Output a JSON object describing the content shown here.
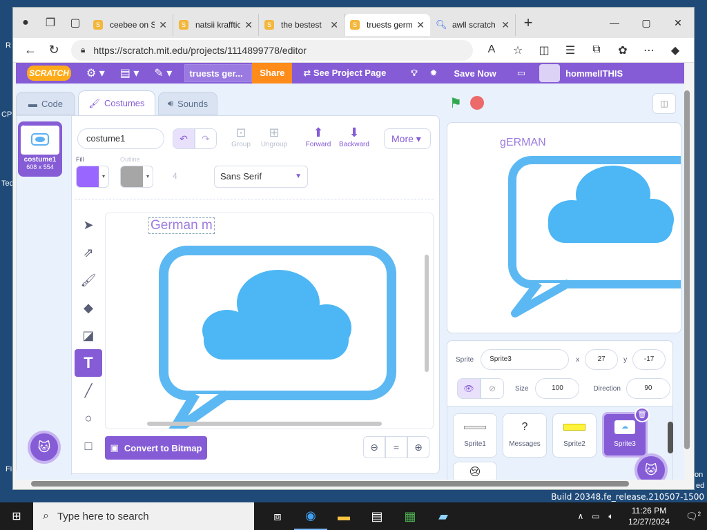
{
  "desktop": {
    "build_info": "Build 20348.fe_release.210507-1500",
    "side_text_1": "R",
    "side_text_2": "CP",
    "side_text_3": "Tec",
    "side_text_4": "Fi",
    "right_text_1": "on",
    "right_text_2": "ed"
  },
  "browser": {
    "tabs": [
      {
        "label": "ceebee on S",
        "favicon": "scratch-favicon"
      },
      {
        "label": "natsii krafftic",
        "favicon": "scratch-favicon"
      },
      {
        "label": "the bestest",
        "favicon": "scratch-favicon"
      },
      {
        "label": "truests germ",
        "favicon": "scratch-favicon",
        "active": true
      },
      {
        "label": "awll scratch",
        "favicon": "search-icon"
      }
    ],
    "url": "https://scratch.mit.edu/projects/1114899778/editor"
  },
  "scratch": {
    "logo": "SCRATCH",
    "project_title": "truests ger...",
    "share_label": "Share",
    "see_project_label": "See Project Page",
    "save_now_label": "Save Now",
    "username": "hommelITHIS",
    "tabs": {
      "code": "Code",
      "costumes": "Costumes",
      "sounds": "Sounds"
    },
    "costume": {
      "number": "1",
      "name": "costume1",
      "size": "608 x 554"
    },
    "paint": {
      "costume_name_value": "costume1",
      "group_label": "Group",
      "ungroup_label": "Ungroup",
      "forward_label": "Forward",
      "backward_label": "Backward",
      "more_label": "More",
      "fill_label": "Fill",
      "outline_label": "Outline",
      "fill_color": "#9966ff",
      "outline_color": "#a6a6a6",
      "stroke_width": "4",
      "font": "Sans Serif",
      "canvas_text": "German m",
      "convert_label": "Convert to Bitmap",
      "zoom_equal": "="
    },
    "stage": {
      "text": "gERMAN"
    },
    "sprite_info": {
      "sprite_label": "Sprite",
      "sprite_name": "Sprite3",
      "x_label": "x",
      "x_value": "27",
      "y_label": "y",
      "y_value": "-17",
      "size_label": "Size",
      "size_value": "100",
      "direction_label": "Direction",
      "direction_value": "90"
    },
    "sprites": [
      {
        "name": "Sprite1"
      },
      {
        "name": "Messages",
        "icon_text": "?"
      },
      {
        "name": "Sprite2"
      },
      {
        "name": "Sprite3",
        "selected": true
      }
    ],
    "accent_color": "#855cd6",
    "orange": "#ff8c1a"
  },
  "taskbar": {
    "search_placeholder": "Type here to search",
    "time": "11:26 PM",
    "date": "12/27/2024",
    "notification_count": "2"
  }
}
